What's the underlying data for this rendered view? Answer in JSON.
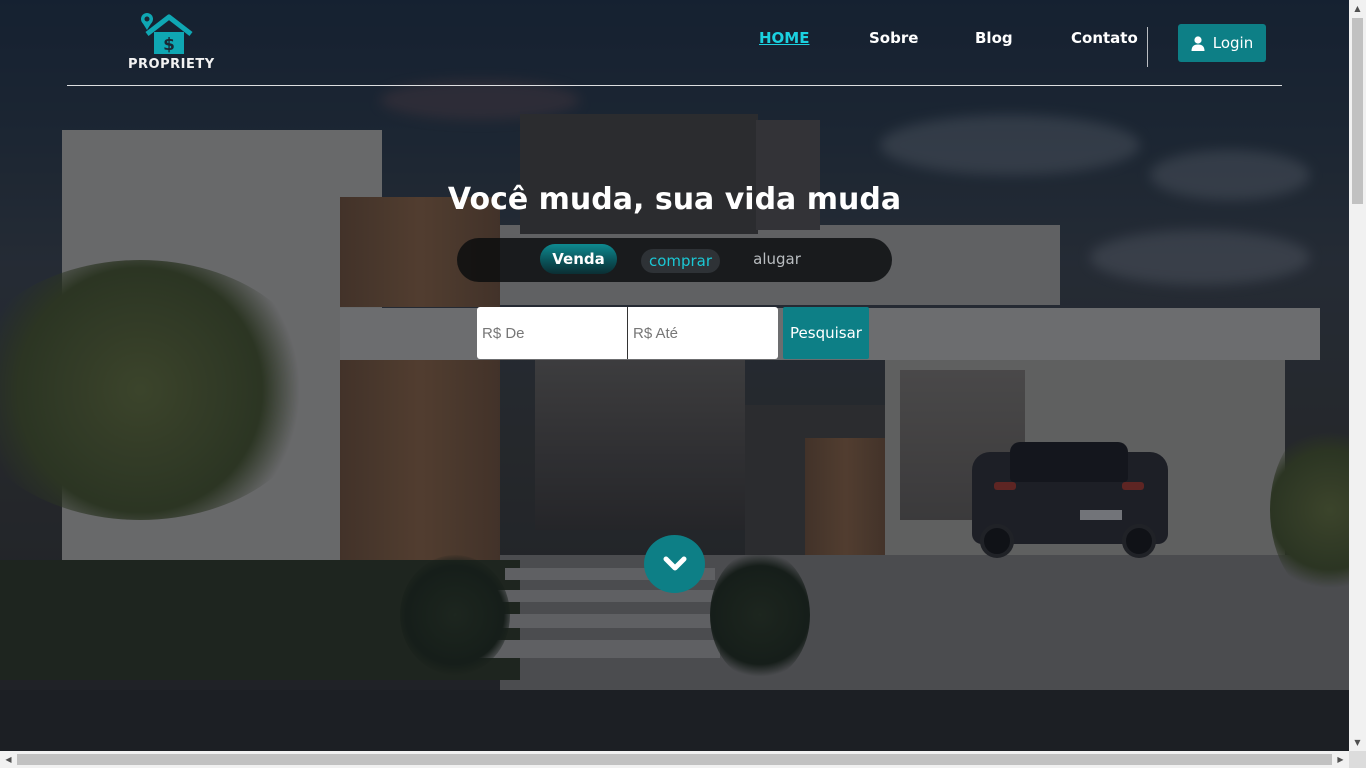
{
  "brand": {
    "name": "PROPRIETY",
    "logo_icon": "house-dollar-pin-icon",
    "accent": "#0d7f86",
    "active_link": "#1bd1e0"
  },
  "nav": {
    "items": [
      {
        "label": "HOME",
        "active": true
      },
      {
        "label": "Sobre",
        "active": false
      },
      {
        "label": "Blog",
        "active": false
      },
      {
        "label": "Contato",
        "active": false
      }
    ],
    "login_label": "Login",
    "login_icon": "user-icon"
  },
  "hero": {
    "headline": "Você muda, sua vida muda",
    "toggle": {
      "venda": "Venda",
      "comprar": "comprar",
      "alugar": "alugar",
      "selected": "Venda"
    },
    "search": {
      "from_placeholder": "R$ De",
      "to_placeholder": "R$ Até",
      "button_label": "Pesquisar"
    },
    "scroll_icon": "chevron-down-icon"
  }
}
